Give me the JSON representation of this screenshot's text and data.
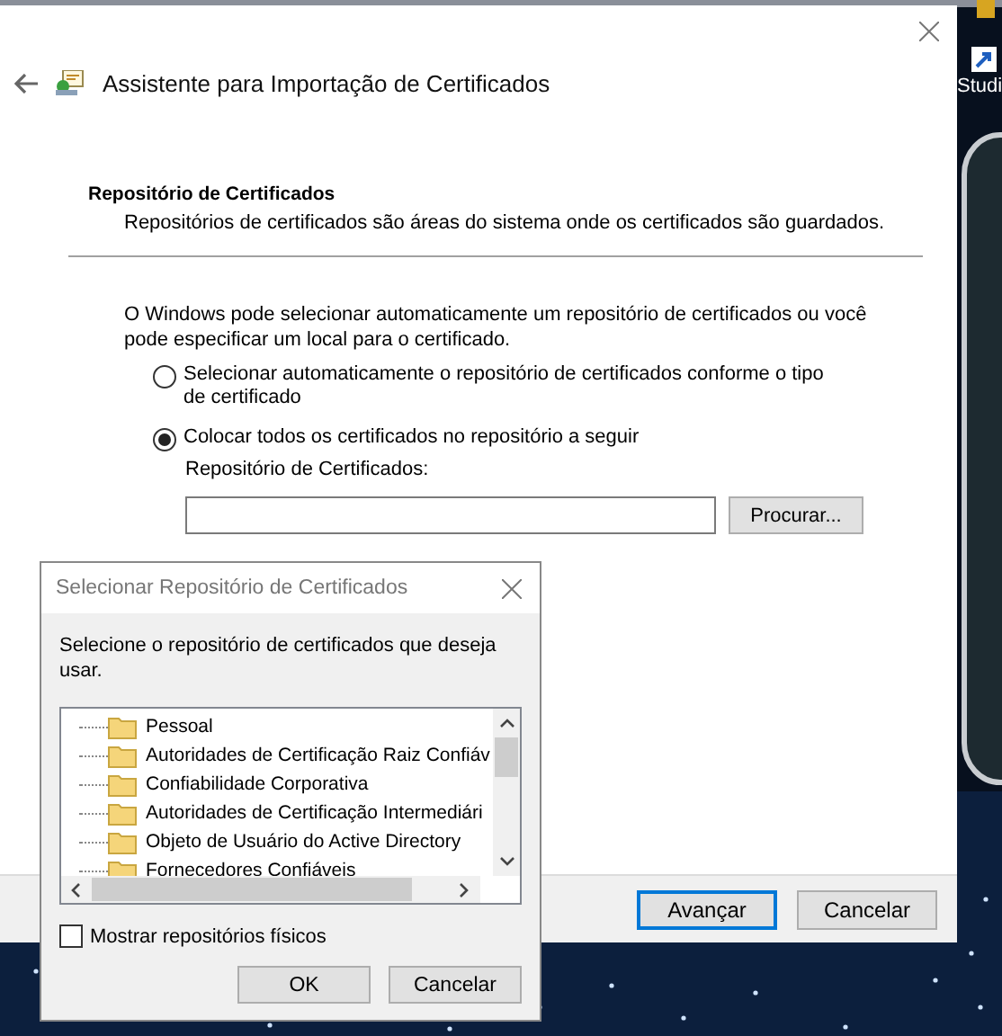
{
  "desktop": {
    "icon_label": "Studi"
  },
  "wizard": {
    "title": "Assistente para Importação de Certificados",
    "section_title": "Repositório de Certificados",
    "section_description": "Repositórios de certificados são áreas do sistema onde os certificados são guardados.",
    "intro": "O Windows pode selecionar automaticamente um repositório de certificados ou você pode especificar um local para o certificado.",
    "options": [
      {
        "label": "Selecionar automaticamente o repositório de certificados conforme o tipo de certificado",
        "selected": false
      },
      {
        "label": "Colocar todos os certificados no repositório a seguir",
        "selected": true
      }
    ],
    "store_label": "Repositório de Certificados:",
    "browse_button": "Procurar...",
    "buttons": [
      {
        "label": "Avançar",
        "default": true
      },
      {
        "label": "Cancelar",
        "default": false
      }
    ]
  },
  "dialog": {
    "title": "Selecionar Repositório de Certificados",
    "prompt": "Selecione o repositório de certificados que deseja usar.",
    "stores": [
      "Pessoal",
      "Autoridades de Certificação Raiz Confiáv",
      "Confiabilidade Corporativa",
      "Autoridades de Certificação Intermediári",
      "Objeto de Usuário do Active Directory",
      "Fornecedores Confiáveis"
    ],
    "show_physical": {
      "label": "Mostrar repositórios físicos",
      "checked": false
    },
    "buttons": [
      "OK",
      "Cancelar"
    ]
  }
}
